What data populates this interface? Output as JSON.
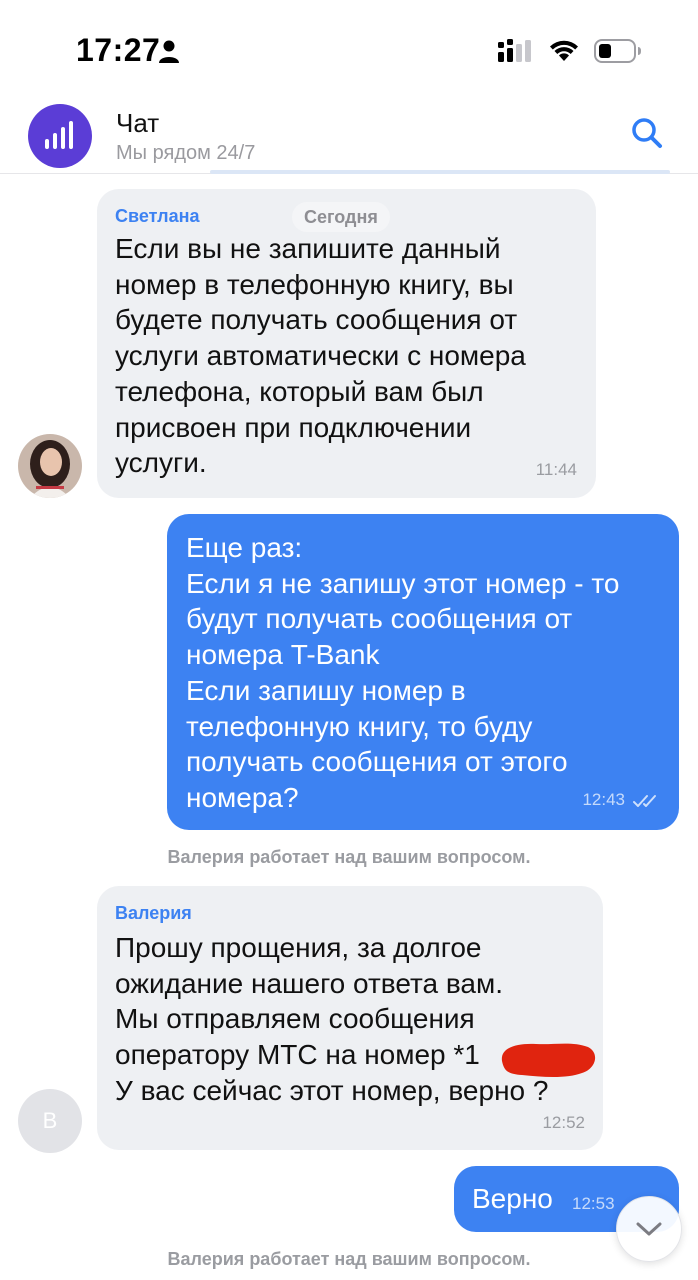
{
  "status_bar": {
    "time": "17:27"
  },
  "header": {
    "title": "Чат",
    "subtitle": "Мы рядом 24/7",
    "avatar_icon": "mts-signal-icon",
    "accent": "#5b3dd6"
  },
  "date_label": "Сегодня",
  "messages": [
    {
      "sender": "Светлана",
      "direction": "in",
      "lines": [
        "Если вы не запишите данный",
        "номер в телефонную книгу, вы",
        "будете получать сообщения от",
        "услуги автоматически с номера",
        "телефона, который вам был",
        "присвоен при подключении",
        "услуги."
      ],
      "time": "11:44"
    },
    {
      "direction": "out",
      "lines": [
        "Еще раз:",
        "Если я не запишу этот номер - то",
        "будут получать сообщения от",
        "номера T-Bank",
        "Если запишу номер в",
        "телефонную книгу, то буду",
        "получать сообщения от этого",
        "номера?"
      ],
      "time": "12:43",
      "status": "read"
    },
    {
      "sender": "Валерия",
      "direction": "in",
      "lines": [
        "Прошу прощения, за долгое",
        "ожидание нашего ответа вам.",
        "Мы отправляем сообщения",
        "оператору МТС на номер *1",
        "У вас сейчас этот номер, верно ?"
      ],
      "time": "12:52",
      "avatar_letter": "В"
    },
    {
      "direction": "out",
      "lines": [
        "Верно"
      ],
      "time": "12:53"
    }
  ],
  "system_notes": [
    "Валерия работает над вашим вопросом.",
    "Валерия работает над вашим вопросом."
  ],
  "colors": {
    "outgoing": "#3d82f2",
    "incoming": "#eef0f3",
    "sender_name": "#3d82f2",
    "redaction": "#e0240f"
  }
}
